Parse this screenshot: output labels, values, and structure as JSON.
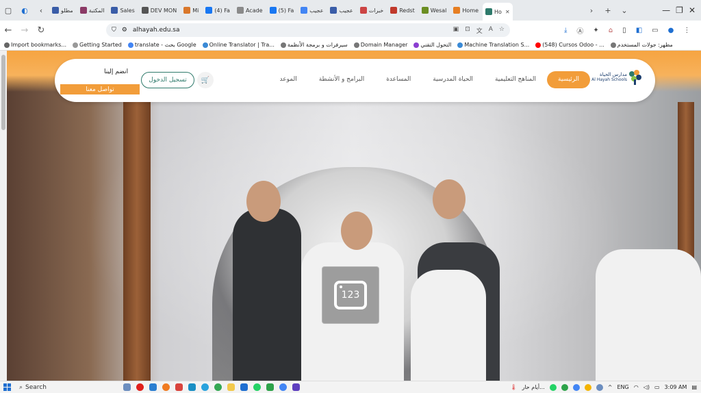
{
  "browser": {
    "tabs": [
      {
        "label": "مطلو",
        "color": "#3a5da8"
      },
      {
        "label": "المكتبة",
        "color": "#8b3a66"
      },
      {
        "label": "Sales",
        "color": "#3a5da8"
      },
      {
        "label": "DEV MON",
        "color": "#555555"
      },
      {
        "label": "Mi",
        "color": "#d9772b"
      },
      {
        "label": "(4) Fa",
        "color": "#1877f2"
      },
      {
        "label": "Acade",
        "color": "#8a8a8a"
      },
      {
        "label": "(5) Fa",
        "color": "#1877f2"
      },
      {
        "label": "عجيب",
        "color": "#4285f4"
      },
      {
        "label": "عجيب",
        "color": "#3a5da8"
      },
      {
        "label": "خبرات",
        "color": "#c44"
      },
      {
        "label": "Redst",
        "color": "#c0392b"
      },
      {
        "label": "Wesal",
        "color": "#6b8e23"
      },
      {
        "label": "Home",
        "color": "#e67e22"
      },
      {
        "label": "Ho",
        "color": "#2e7a6b",
        "active": true
      }
    ],
    "url": "alhayah.edu.sa",
    "bookmarks": [
      {
        "label": "Import bookmarks...",
        "color": "#666666"
      },
      {
        "label": "Getting Started",
        "color": "#999999"
      },
      {
        "label": "translate - بحث Google",
        "color": "#4285f4"
      },
      {
        "label": "Online Translator | Tra...",
        "color": "#3a8ad6"
      },
      {
        "label": "سيرفرات و برمجة الأنظمة",
        "color": "#777777"
      },
      {
        "label": "Domain Manager",
        "color": "#777777"
      },
      {
        "label": "التحول التقني",
        "color": "#8b3fd1"
      },
      {
        "label": "Machine Translation S...",
        "color": "#3a8ad6"
      },
      {
        "label": "(548) Cursos Odoo - ...",
        "color": "#ff0000"
      },
      {
        "label": "مطهر: جولات المستخدم",
        "color": "#777777"
      }
    ]
  },
  "site": {
    "logo_text_ar": "مدارس الحياة",
    "logo_text_en": "Al Hayah Schools",
    "nav": [
      {
        "label": "الرئيسية",
        "active": true
      },
      {
        "label": "المناهج التعليمية"
      },
      {
        "label": "الحياة المدرسية"
      },
      {
        "label": "المساعدة"
      },
      {
        "label": "البرامج و الأنشطة"
      },
      {
        "label": "الموعد"
      }
    ],
    "login_label": "تسجيل الدخول",
    "join_label": "انضم إلينا",
    "contact_label": "تواصل معنا",
    "overlay_number": "123",
    "accent": "#f29d3a",
    "teal": "#2e7a6b"
  },
  "taskbar": {
    "search_label": "Search",
    "weather_label": "أيام حار...",
    "language": "ENG",
    "time": "3:09 AM"
  }
}
